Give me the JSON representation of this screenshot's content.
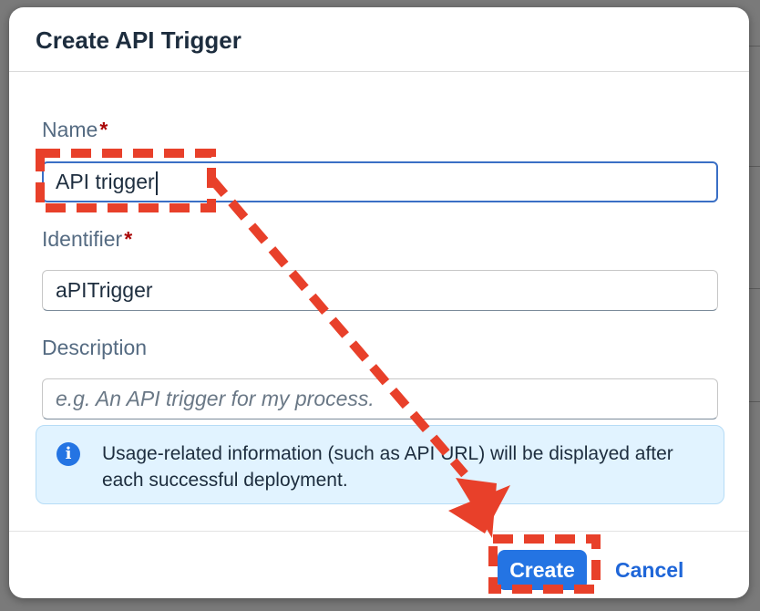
{
  "dialog": {
    "title": "Create API Trigger",
    "fields": {
      "name": {
        "label": "Name",
        "required_mark": "*",
        "value": "API trigger"
      },
      "identifier": {
        "label": "Identifier",
        "required_mark": "*",
        "value": "aPITrigger"
      },
      "description": {
        "label": "Description",
        "placeholder": "e.g. An API trigger for my process."
      }
    },
    "info": {
      "icon": "info-icon",
      "text": "Usage-related information (such as API URL) will be displayed after each successful deployment."
    },
    "footer": {
      "create_label": "Create",
      "cancel_label": "Cancel"
    }
  },
  "colors": {
    "accent": "#2474e3",
    "annotation": "#e8402a",
    "required": "#aa0808"
  }
}
